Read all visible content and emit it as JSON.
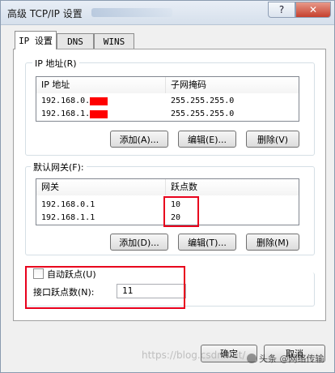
{
  "window": {
    "title": "高级 TCP/IP 设置",
    "help_glyph": "?",
    "close_glyph": "✕"
  },
  "tabs": [
    {
      "label": "IP 设置",
      "active": true
    },
    {
      "label": "DNS",
      "active": false
    },
    {
      "label": "WINS",
      "active": false
    }
  ],
  "ip_group": {
    "label": "IP 地址(R)",
    "columns": [
      "IP 地址",
      "子网掩码"
    ],
    "rows": [
      {
        "ip": "192.168.0.",
        "mask": "255.255.255.0"
      },
      {
        "ip": "192.168.1.",
        "mask": "255.255.255.0"
      }
    ],
    "buttons": {
      "add": "添加(A)...",
      "edit": "编辑(E)...",
      "remove": "删除(V)"
    }
  },
  "gateway_group": {
    "label": "默认网关(F):",
    "columns": [
      "网关",
      "跃点数"
    ],
    "rows": [
      {
        "gateway": "192.168.0.1",
        "metric": "10"
      },
      {
        "gateway": "192.168.1.1",
        "metric": "20"
      }
    ],
    "buttons": {
      "add": "添加(D)...",
      "edit": "编辑(T)...",
      "remove": "删除(M)"
    }
  },
  "metric_group": {
    "auto_metric_label": "自动跃点(U)",
    "auto_metric_checked": false,
    "interface_metric_label": "接口跃点数(N):",
    "interface_metric_value": "11"
  },
  "footer": {
    "ok": "确定",
    "cancel": "取消"
  },
  "watermark": {
    "text": "https://blog.csdn.net/",
    "logo": "头条 @网络传输"
  },
  "colors": {
    "highlight_red": "#e8001c",
    "redaction": "#ff0000"
  }
}
